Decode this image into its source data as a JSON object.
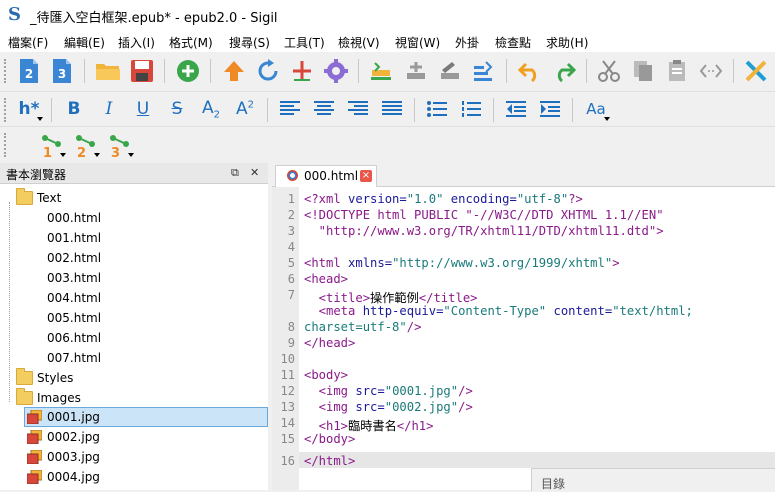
{
  "window": {
    "title": "_待匯入空白框架.epub* - epub2.0 - Sigil",
    "logo": "S"
  },
  "menu": [
    "檔案(F)",
    "編輯(E)",
    "插入(I)",
    "格式(M)",
    "搜尋(S)",
    "工具(T)",
    "檢視(V)",
    "視窗(W)",
    "外掛",
    "檢查點",
    "求助(H)"
  ],
  "toolbar": {
    "heading_label": "h*",
    "bold": "B",
    "italic": "I",
    "underline": "U",
    "strike": "S",
    "subscript": "A",
    "subscript_mark": "2",
    "superscript": "A",
    "superscript_mark": "2",
    "case_label": "Aa",
    "plugin1": "1",
    "plugin2": "2",
    "plugin3": "3"
  },
  "book_browser": {
    "title": "書本瀏覽器",
    "folders": {
      "text": "Text",
      "styles": "Styles",
      "images": "Images"
    },
    "text_files": [
      "000.html",
      "001.html",
      "002.html",
      "003.html",
      "004.html",
      "005.html",
      "006.html",
      "007.html"
    ],
    "image_files": [
      "0001.jpg",
      "0002.jpg",
      "0003.jpg",
      "0004.jpg"
    ],
    "selected": "0001.jpg"
  },
  "editor": {
    "tab_label": "000.html",
    "tab_close": "×",
    "line_numbers": [
      "1",
      "2",
      "3",
      "4",
      "5",
      "6",
      "7",
      "8",
      "9",
      "10",
      "11",
      "12",
      "13",
      "14",
      "15",
      "16"
    ],
    "lines": {
      "l1a": "<?xml ",
      "l1b": "version=",
      "l1c": "\"1.0\" ",
      "l1d": "encoding=",
      "l1e": "\"utf-8\"",
      "l1f": "?>",
      "l2a": "<!DOCTYPE html PUBLIC \"-//W3C//DTD XHTML 1.1//EN\"",
      "l2b": "  \"http://www.w3.org/TR/xhtml11/DTD/xhtml11.dtd\">",
      "l4a": "<html ",
      "l4b": "xmlns=",
      "l4c": "\"http://www.w3.org/1999/xhtml\"",
      "l4d": ">",
      "l5": "<head>",
      "l6a": "  <title>",
      "l6b": "操作範例",
      "l6c": "</title>",
      "l7a": "  <meta ",
      "l7b": "http-equiv=",
      "l7c": "\"Content-Type\" ",
      "l7d": "content=",
      "l7e": "\"text/html;",
      "l7f": "charset=utf-8\"",
      "l7g": "/>",
      "l8": "</head>",
      "l10": "<body>",
      "l11a": "  <img ",
      "l11b": "src=",
      "l11c": "\"0001.jpg\"",
      "l11d": "/>",
      "l12a": "  <img ",
      "l12b": "src=",
      "l12c": "\"0002.jpg\"",
      "l12d": "/>",
      "l13a": "  <h1>",
      "l13b": "臨時書名",
      "l13c": "</h1>",
      "l14": "</body>",
      "l15": "</html>"
    }
  },
  "toc_panel": {
    "title": "目錄"
  },
  "colors": {
    "accent": "#1f6fbf",
    "tag": "#8a1a8a",
    "attribute": "#1a1a9a",
    "value": "#1a7a7a",
    "selection": "#cce4f7"
  }
}
